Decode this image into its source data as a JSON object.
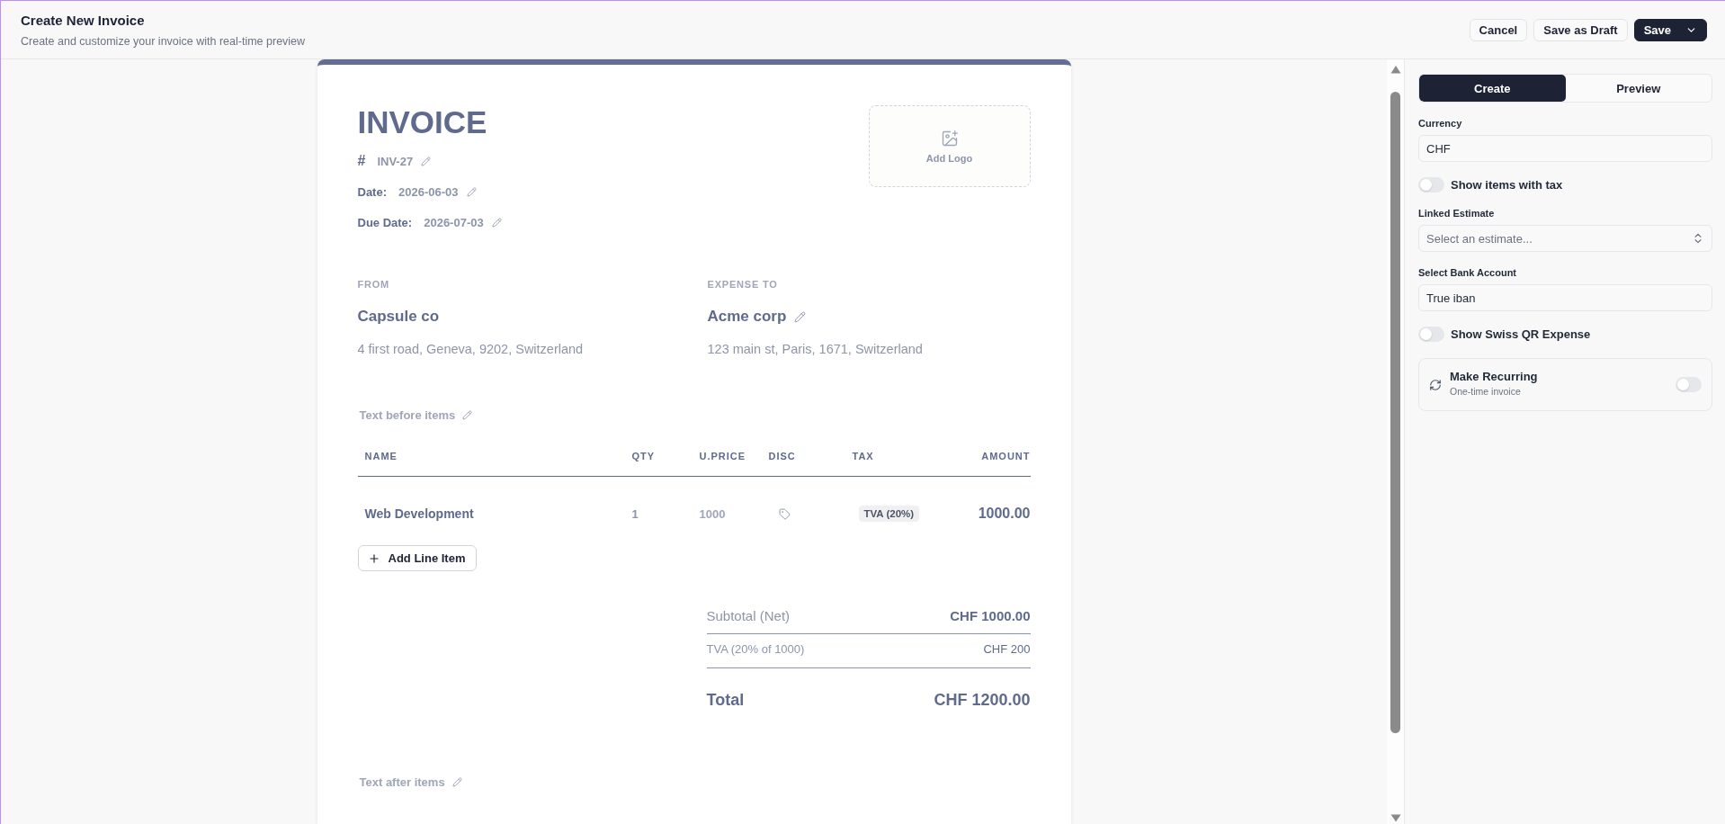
{
  "header": {
    "title": "Create New Invoice",
    "subtitle": "Create and customize your invoice with real-time preview",
    "buttons": [
      {
        "label": "Cancel",
        "kind": "outline",
        "dropdown": false
      },
      {
        "label": "Save as Draft",
        "kind": "outline",
        "dropdown": false
      },
      {
        "label": "Save",
        "kind": "primary",
        "dropdown": true
      }
    ]
  },
  "invoice": {
    "title": "INVOICE",
    "meta": [
      {
        "kind": "number",
        "label": "#",
        "value": "INV-27"
      },
      {
        "kind": "date",
        "label": "Date:",
        "value": "2026-06-03"
      },
      {
        "kind": "date",
        "label": "Due Date:",
        "value": "2026-07-03"
      }
    ],
    "logo": {
      "label": "Add Logo"
    },
    "parties": [
      {
        "heading": "FROM",
        "name": "Capsule co",
        "address": "4 first road, Geneva, 9202, Switzerland",
        "editable": false
      },
      {
        "heading": "EXPENSE TO",
        "name": "Acme corp",
        "address": "123 main st, Paris, 1671, Switzerland",
        "editable": true
      }
    ],
    "text_before": "Text before items",
    "table": {
      "columns": [
        "NAME",
        "QTY",
        "U.PRICE",
        "DISC",
        "TAX",
        "AMOUNT"
      ],
      "rows": [
        {
          "name": "Web Development",
          "qty": "1",
          "unit_price": "1000",
          "tax": "TVA (20%)",
          "amount": "1000.00"
        }
      ]
    },
    "add_line_label": "Add Line Item",
    "totals": [
      {
        "kind": "subtotal",
        "label": "Subtotal (Net)",
        "value": "CHF 1000.00"
      },
      {
        "kind": "tax",
        "label": "TVA (20% of 1000)",
        "value": "CHF 200"
      },
      {
        "kind": "total",
        "label": "Total",
        "value": "CHF 1200.00"
      }
    ],
    "text_after": "Text after items"
  },
  "panel": {
    "tabs": [
      {
        "label": "Create",
        "selected": true
      },
      {
        "label": "Preview",
        "selected": false
      }
    ],
    "fields": [
      {
        "kind": "input",
        "label": "Currency",
        "value": "CHF"
      },
      {
        "kind": "toggle",
        "label": "Show items with tax",
        "on": false
      },
      {
        "kind": "select",
        "label": "Linked Estimate",
        "placeholder": "Select an estimate..."
      },
      {
        "kind": "input",
        "label": "Select Bank Account",
        "value": "True iban"
      },
      {
        "kind": "toggle",
        "label": "Show Swiss QR Expense",
        "on": false
      }
    ],
    "recurring": {
      "title": "Make Recurring",
      "subtitle": "One-time invoice",
      "on": false
    }
  }
}
